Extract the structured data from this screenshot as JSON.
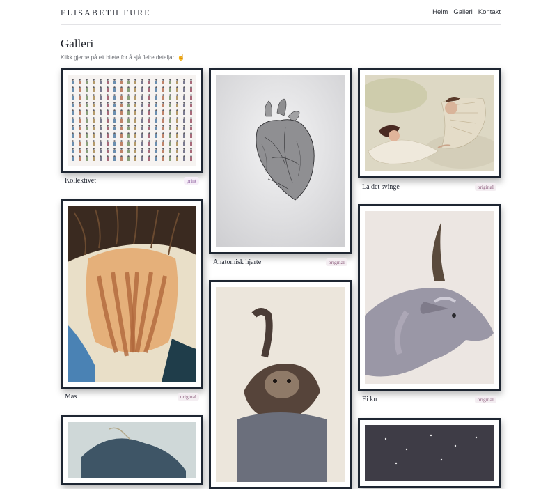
{
  "header": {
    "brand": "ELISABETH FURE",
    "nav": [
      "Heim",
      "Galleri",
      "Kontakt"
    ],
    "active": "Galleri"
  },
  "page": {
    "title": "Galleri",
    "subtitle": "Klikk gjerne på eit bilete for å sjå fleire detaljar",
    "subtitle_icon": "pointer-icon"
  },
  "gallery": [
    {
      "title": "Kollektivet",
      "type": "print"
    },
    {
      "title": "Anatomisk hjarte",
      "type": "original"
    },
    {
      "title": "La det svinge",
      "type": "original"
    },
    {
      "title": "Mas",
      "type": "original"
    },
    {
      "title": "Ei ku",
      "type": "original"
    }
  ],
  "colors": {
    "frame": "#1e2632",
    "tag_text": "#8a5a7a",
    "divider": "#e3e3e6"
  }
}
